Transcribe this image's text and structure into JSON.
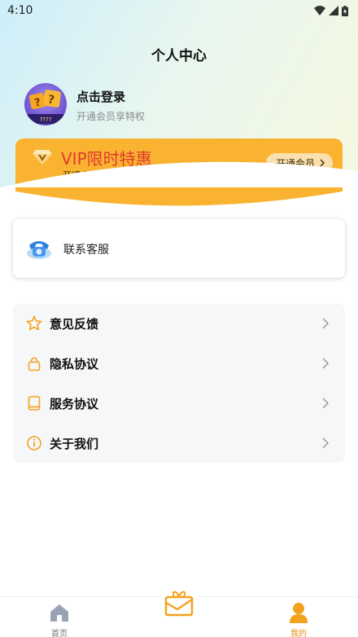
{
  "status_bar": {
    "time": "4:10"
  },
  "header": {
    "title": "个人中心"
  },
  "profile": {
    "login_label": "点击登录",
    "subtitle": "开通会员享特权",
    "avatar_text": "????"
  },
  "vip": {
    "title": "VIP限时特惠",
    "subtitle": "开通会员，  享多项权益",
    "button_label": "开通会员"
  },
  "service": {
    "label": "联系客服"
  },
  "menu": {
    "items": [
      {
        "label": "意见反馈",
        "icon": "star-icon"
      },
      {
        "label": "隐私协议",
        "icon": "lock-icon"
      },
      {
        "label": "服务协议",
        "icon": "book-icon"
      },
      {
        "label": "关于我们",
        "icon": "info-icon"
      }
    ]
  },
  "tabbar": {
    "items": [
      {
        "label": "首页",
        "icon": "home-icon"
      },
      {
        "label": "",
        "icon": "gift-box-icon"
      },
      {
        "label": "我的",
        "icon": "user-icon"
      }
    ]
  },
  "colors": {
    "accent": "#f9b331",
    "vip_title": "#e23a2f",
    "active_tab": "#e98d11"
  }
}
